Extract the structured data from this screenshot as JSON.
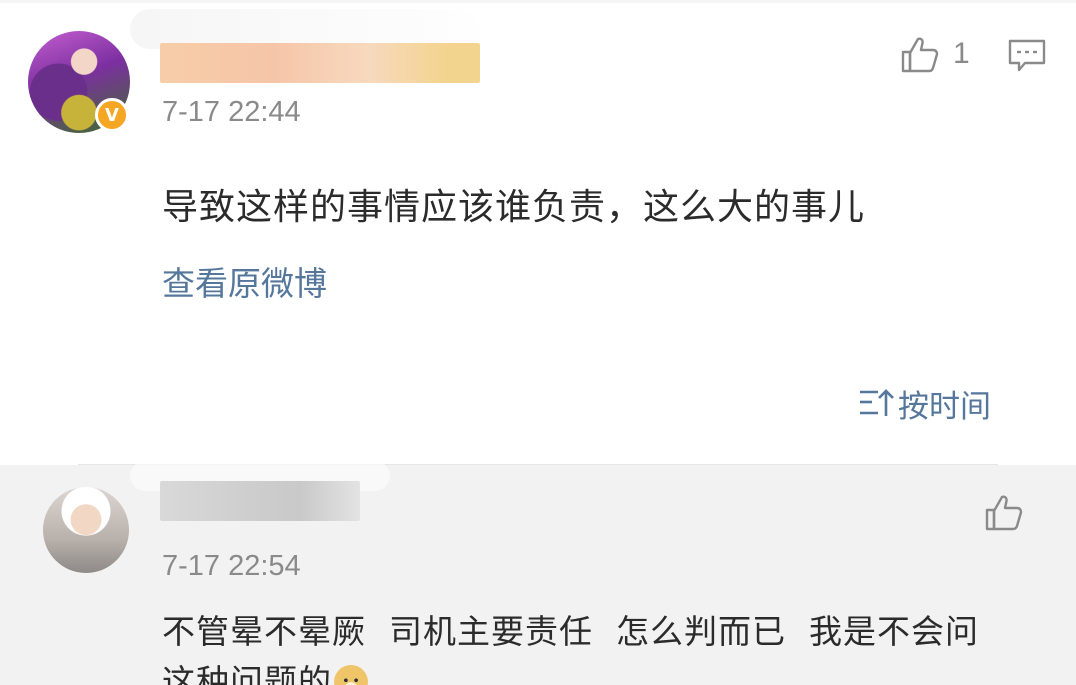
{
  "main_comment": {
    "timestamp": "7-17 22:44",
    "like_count": "1",
    "text": "导致这样的事情应该谁负责，这么大的事儿",
    "view_original_label": "查看原微博",
    "icons": {
      "verified": "verified-badge-icon",
      "like": "thumbs-up-icon",
      "reply": "comment-bubble-icon"
    }
  },
  "sort": {
    "label": "按时间",
    "icon": "sort-by-time-icon"
  },
  "reply_comment": {
    "timestamp": "7-17 22:54",
    "text_line1": "不管晕不晕厥  司机主要责任  怎么判而已  我是不会问",
    "text_line2": "这种问题的",
    "icons": {
      "like": "thumbs-up-icon",
      "emoji": "doge-emoji-icon"
    }
  },
  "colors": {
    "link": "#56779c",
    "secondary_text": "#8a8a8a",
    "verified": "#f5a623",
    "reply_background": "#f2f2f2"
  }
}
